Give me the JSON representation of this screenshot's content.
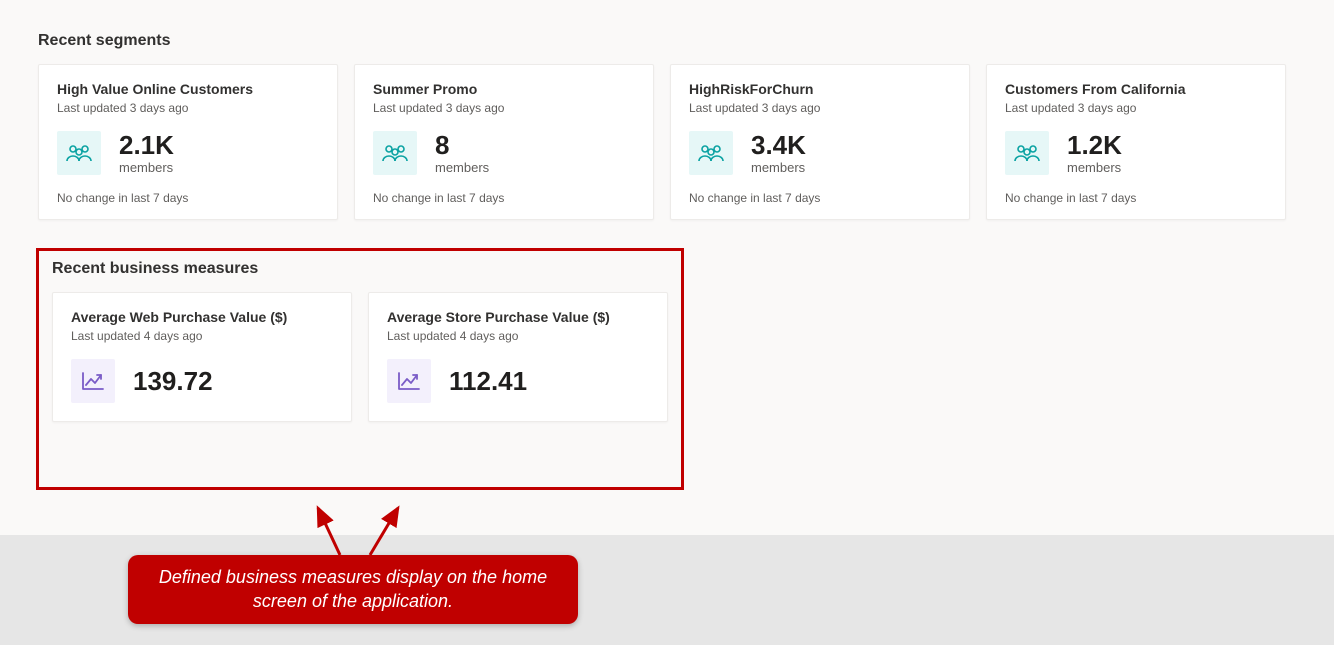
{
  "segments": {
    "title": "Recent segments",
    "cards": [
      {
        "title": "High Value Online Customers",
        "subtitle": "Last updated 3 days ago",
        "value": "2.1K",
        "label": "members",
        "footer": "No change in last 7 days"
      },
      {
        "title": "Summer Promo",
        "subtitle": "Last updated 3 days ago",
        "value": "8",
        "label": "members",
        "footer": "No change in last 7 days"
      },
      {
        "title": "HighRiskForChurn",
        "subtitle": "Last updated 3 days ago",
        "value": "3.4K",
        "label": "members",
        "footer": "No change in last 7 days"
      },
      {
        "title": "Customers From California",
        "subtitle": "Last updated 3 days ago",
        "value": "1.2K",
        "label": "members",
        "footer": "No change in last 7 days"
      }
    ]
  },
  "measures": {
    "title": "Recent business measures",
    "cards": [
      {
        "title": "Average Web Purchase Value ($)",
        "subtitle": "Last updated 4 days ago",
        "value": "139.72"
      },
      {
        "title": "Average Store Purchase Value ($)",
        "subtitle": "Last updated 4 days ago",
        "value": "112.41"
      }
    ]
  },
  "annotation": "Defined business measures display on the home screen of the application."
}
